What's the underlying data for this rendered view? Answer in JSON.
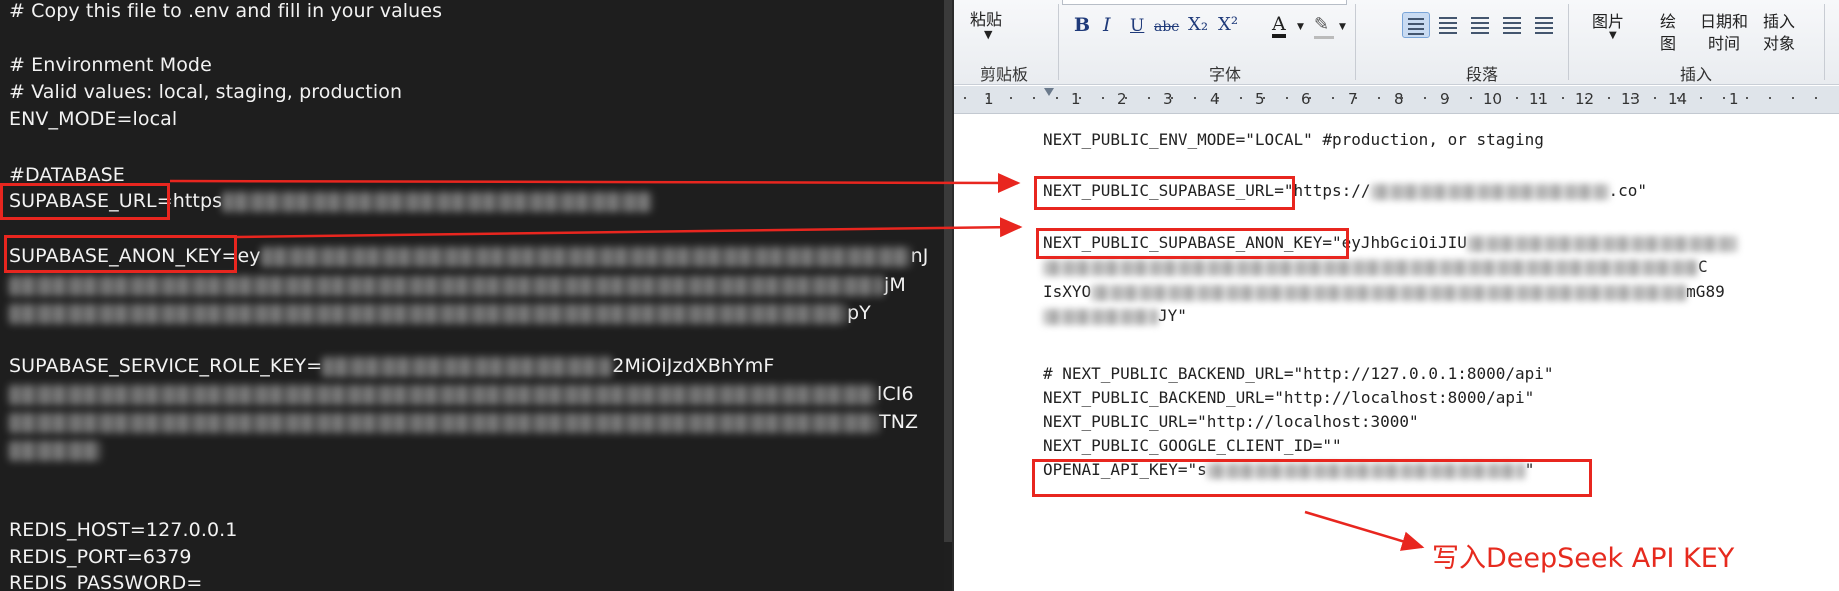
{
  "editor": {
    "lines": [
      "# Copy this file to .env and fill in your values",
      "# Environment Mode",
      "# Valid values: local, staging, production",
      "ENV_MODE=local",
      "#DATABASE",
      "SUPABASE_URL=https",
      "SUPABASE_ANON_KEY=ey",
      "SUPABASE_SERVICE_ROLE_KEY=",
      "REDIS_HOST=127.0.0.1",
      "REDIS_PORT=6379",
      "REDIS_PASSWORD="
    ],
    "url_value_prefix": "https",
    "anon_value_prefix": "ey",
    "anon_line1_suffix": "nJ",
    "anon_line2_suffix": "jM",
    "anon_line3_suffix": "pY",
    "service_line1_suffix": "2MiOiJzdXBhYmF",
    "service_line2_suffix": "lCI6",
    "service_line3_suffix": "TNZ"
  },
  "ribbon": {
    "paste": "粘贴",
    "clipboard_group": "剪贴板",
    "font_group": "字体",
    "paragraph_group": "段落",
    "insert_group": "插入",
    "picture": "图片",
    "draw_top": "绘",
    "draw_bottom": "图",
    "datetime_top": "日期和",
    "datetime_bottom": "时间",
    "insert_obj_top": "插入",
    "insert_obj_bottom": "对象",
    "bold": "B",
    "italic": "I",
    "underline": "U",
    "strike": "abc",
    "subscript": "X₂",
    "superscript": "X²",
    "font_color": "A"
  },
  "ruler": {
    "numbers": [
      "1",
      "1",
      "2",
      "3",
      "4",
      "5",
      "6",
      "7",
      "8",
      "9",
      "10",
      "11",
      "12",
      "13",
      "14",
      "1"
    ]
  },
  "document": {
    "line_env": "NEXT_PUBLIC_ENV_MODE=\"LOCAL\" #production, or staging",
    "line_url_key": "NEXT_PUBLIC_SUPABASE_URL",
    "line_url_val_start": "=\"https://",
    "line_url_val_end": ".co\"",
    "line_anon_key": "NEXT_PUBLIC_SUPABASE_ANON_KEY",
    "line_anon_val_start": "=\"eyJhbGciOiJIU",
    "line_anon2_end": "C",
    "line_anon3_start": "IsXYO",
    "line_anon3_end": "mG89",
    "line_anon4_end": "JY\"",
    "line_backend_comment": "# NEXT_PUBLIC_BACKEND_URL=\"http://127.0.0.1:8000/api\"",
    "line_backend": "NEXT_PUBLIC_BACKEND_URL=\"http://localhost:8000/api\"",
    "line_public_url": "NEXT_PUBLIC_URL=\"http://localhost:3000\"",
    "line_google": "NEXT_PUBLIC_GOOGLE_CLIENT_ID=\"\"",
    "line_openai_start": "OPENAI_API_KEY=\"s",
    "line_openai_end": "\""
  },
  "callout": "写入DeepSeek API KEY",
  "colors": {
    "highlight": "#e8261f",
    "editor_bg": "#1e1e1e",
    "ribbon_bg": "#eef0f3"
  }
}
